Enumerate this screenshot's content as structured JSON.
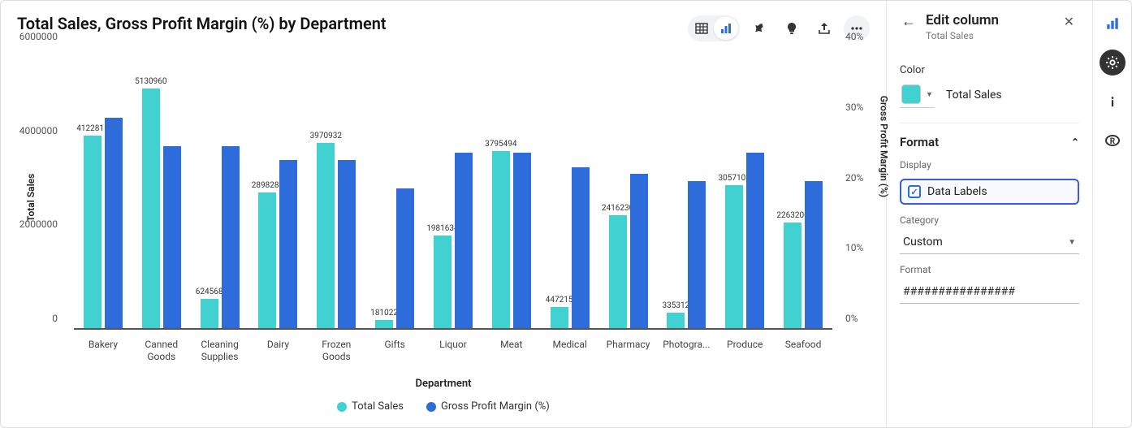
{
  "title": "Total Sales, Gross Profit Margin (%) by Department",
  "axes": {
    "y_label": "Total Sales",
    "y2_label": "Gross Profit Margin (%)",
    "x_label": "Department",
    "y_ticks": [
      "0",
      "2000000",
      "4000000",
      "6000000"
    ],
    "y2_ticks": [
      "0%",
      "10%",
      "20%",
      "30%",
      "40%"
    ]
  },
  "legend": {
    "s1": "Total Sales",
    "s2": "Gross Profit Margin (%)"
  },
  "sidebar": {
    "title": "Edit column",
    "subtitle": "Total Sales",
    "color_label": "Color",
    "color_name": "Total Sales",
    "format_header": "Format",
    "display_label": "Display",
    "data_labels": "Data Labels",
    "category_label": "Category",
    "category_value": "Custom",
    "format_label": "Format",
    "format_value": "################"
  },
  "chart_data": {
    "type": "bar",
    "categories": [
      "Bakery",
      "Canned Goods",
      "Cleaning Supplies",
      "Dairy",
      "Frozen Goods",
      "Gifts",
      "Liquor",
      "Meat",
      "Medical",
      "Pharmacy",
      "Photogra...",
      "Produce",
      "Seafood"
    ],
    "series": [
      {
        "name": "Total Sales",
        "values": [
          4122811,
          5130960,
          624568,
          2898285,
          3970932,
          181022,
          1981634,
          3795494,
          447215,
          2416230,
          335312,
          3057105,
          2263206
        ],
        "labels": [
          "4122811",
          "5130960",
          "624568",
          "2898285",
          "3970932",
          "181022",
          "1981634",
          "3795494",
          "447215",
          "2416230",
          "335312",
          "3057105",
          "2263206"
        ],
        "axis": "y"
      },
      {
        "name": "Gross Profit Margin (%)",
        "values": [
          30,
          26,
          26,
          24,
          24,
          20,
          25,
          25,
          23,
          22,
          21,
          25,
          21
        ],
        "axis": "y2"
      }
    ],
    "ylim": [
      0,
      6000000
    ],
    "y2lim": [
      0,
      40
    ],
    "xlabel": "Department",
    "ylabel": "Total Sales",
    "y2label": "Gross Profit Margin (%)",
    "title": "Total Sales, Gross Profit Margin (%) by Department"
  }
}
